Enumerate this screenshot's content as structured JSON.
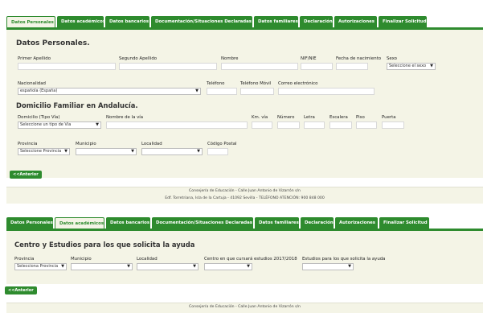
{
  "tabs1": [
    {
      "label": "Datos Personales",
      "active": true
    },
    {
      "label": "Datos académicos",
      "active": false
    },
    {
      "label": "Datos bancarios",
      "active": false
    },
    {
      "label": "Documentación/Situaciones Declaradas",
      "active": false
    },
    {
      "label": "Datos familiares",
      "active": false
    },
    {
      "label": "Declaración",
      "active": false
    },
    {
      "label": "Autorizaciones",
      "active": false
    },
    {
      "label": "Finalizar Solicitud",
      "active": false
    }
  ],
  "personal": {
    "title": "Datos Personales.",
    "primer_apellido": "Primer Apellido",
    "segundo_apellido": "Segundo Apellido",
    "nombre": "Nombre",
    "nif": "NIF/NIE",
    "fecha_nacimiento": "Fecha de nacimiento",
    "sexo": "Sexo",
    "sexo_value": "Seleccione el sexo",
    "nacionalidad": "Nacionalidad",
    "nacionalidad_value": "española (España)",
    "telefono": "Teléfono",
    "telefono_movil": "Teléfono Móvil",
    "correo": "Correo electrónico"
  },
  "domicilio": {
    "title": "Domicilio Familiar en Andalucía.",
    "tipo_via": "Domicilio (Tipo Vía)",
    "tipo_via_value": "Seleccione un tipo de Vía",
    "nombre_via": "Nombre de la vía",
    "km_via": "Km. vía",
    "numero": "Número",
    "letra": "Letra",
    "escalera": "Escalera",
    "piso": "Piso",
    "puerta": "Puerta",
    "provincia": "Provincia",
    "provincia_value": "Seleccione Provincia",
    "municipio": "Municipio",
    "localidad": "Localidad",
    "codigo_postal": "Código Postal"
  },
  "anterior_label": "<<Anterior",
  "footer": {
    "line1": "Consejería de Educación - Calle Juan Antonio de Vizarrón s/n",
    "line2": "Edf. Torretriana, Isla de la Cartuja - 41092 Sevilla - TELÉFONO ATENCIÓN: 900 848 000"
  },
  "tabs2": [
    {
      "label": "Datos Personales",
      "active": false
    },
    {
      "label": "Datos académicos",
      "active": true
    },
    {
      "label": "Datos bancarios",
      "active": false
    },
    {
      "label": "Documentación/Situaciones Declaradas",
      "active": false
    },
    {
      "label": "Datos familiares",
      "active": false
    },
    {
      "label": "Declaración",
      "active": false
    },
    {
      "label": "Autorizaciones",
      "active": false
    },
    {
      "label": "Finalizar Solicitud",
      "active": false
    }
  ],
  "centro": {
    "title": "Centro y Estudios para los que solicita la ayuda",
    "provincia": "Provincia",
    "provincia_value": "Selecciona Provincia",
    "municipio": "Municipio",
    "localidad": "Localidad",
    "centro": "Centro en que cursará estudios 2017/2018",
    "estudios": "Estudios para los que solicita la ayuda"
  },
  "footer2": {
    "line1": "Consejería de Educación - Calle Juan Antonio de Vizarrón s/n"
  }
}
